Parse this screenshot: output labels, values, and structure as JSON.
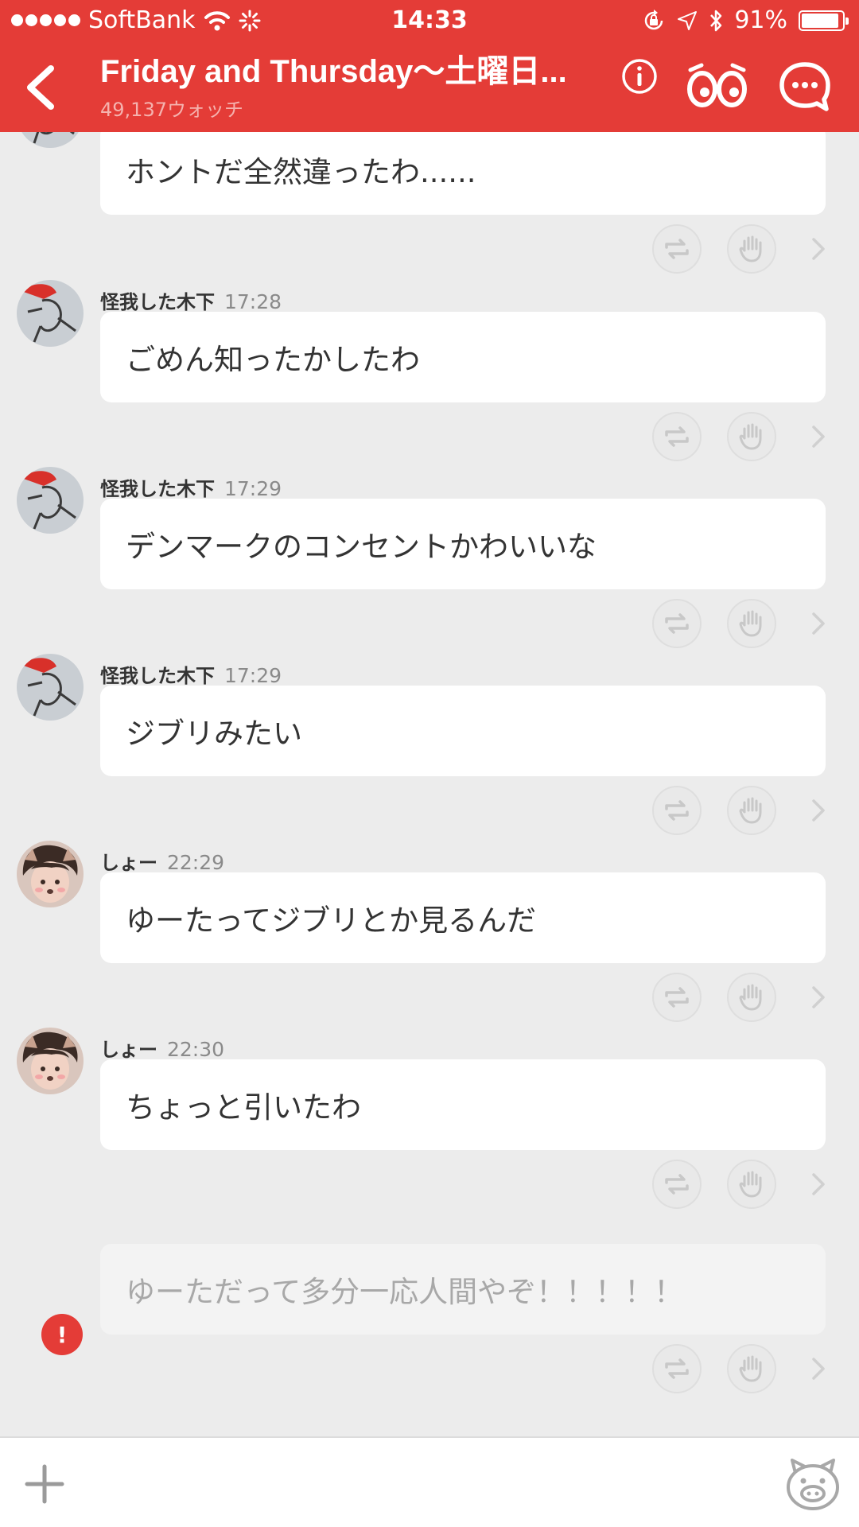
{
  "status_bar": {
    "carrier": "SoftBank",
    "time": "14:33",
    "battery": "91%",
    "battery_level": 0.91
  },
  "nav": {
    "title": "Friday and Thursday〜土曜日...",
    "watch_count": "49,137ウォッチ",
    "icons": [
      "back-chevron-icon",
      "info-icon",
      "watch-eyes-icon",
      "chat-bubble-icon"
    ]
  },
  "messages": [
    {
      "sender": "",
      "time": "",
      "text": "ホントだ全然違ったわ......",
      "avatar": "kinoshita"
    },
    {
      "sender": "怪我した木下",
      "time": "17:28",
      "text": "ごめん知ったかしたわ",
      "avatar": "kinoshita"
    },
    {
      "sender": "怪我した木下",
      "time": "17:29",
      "text": "デンマークのコンセントかわいいな",
      "avatar": "kinoshita"
    },
    {
      "sender": "怪我した木下",
      "time": "17:29",
      "text": "ジブリみたい",
      "avatar": "kinoshita"
    },
    {
      "sender": "しょー",
      "time": "22:29",
      "text": "ゆーたってジブリとか見るんだ",
      "avatar": "sho"
    },
    {
      "sender": "しょー",
      "time": "22:30",
      "text": "ちょっと引いたわ",
      "avatar": "sho"
    }
  ],
  "pending_message": {
    "text": "ゆーただって多分一応人間やぞ！！！！！",
    "error_mark": "!"
  },
  "bottom_bar": {
    "icons": [
      "plus-icon",
      "pig-stamp-icon"
    ]
  },
  "colors": {
    "accent": "#e43c37",
    "background": "#ececec",
    "bubble": "#ffffff"
  }
}
